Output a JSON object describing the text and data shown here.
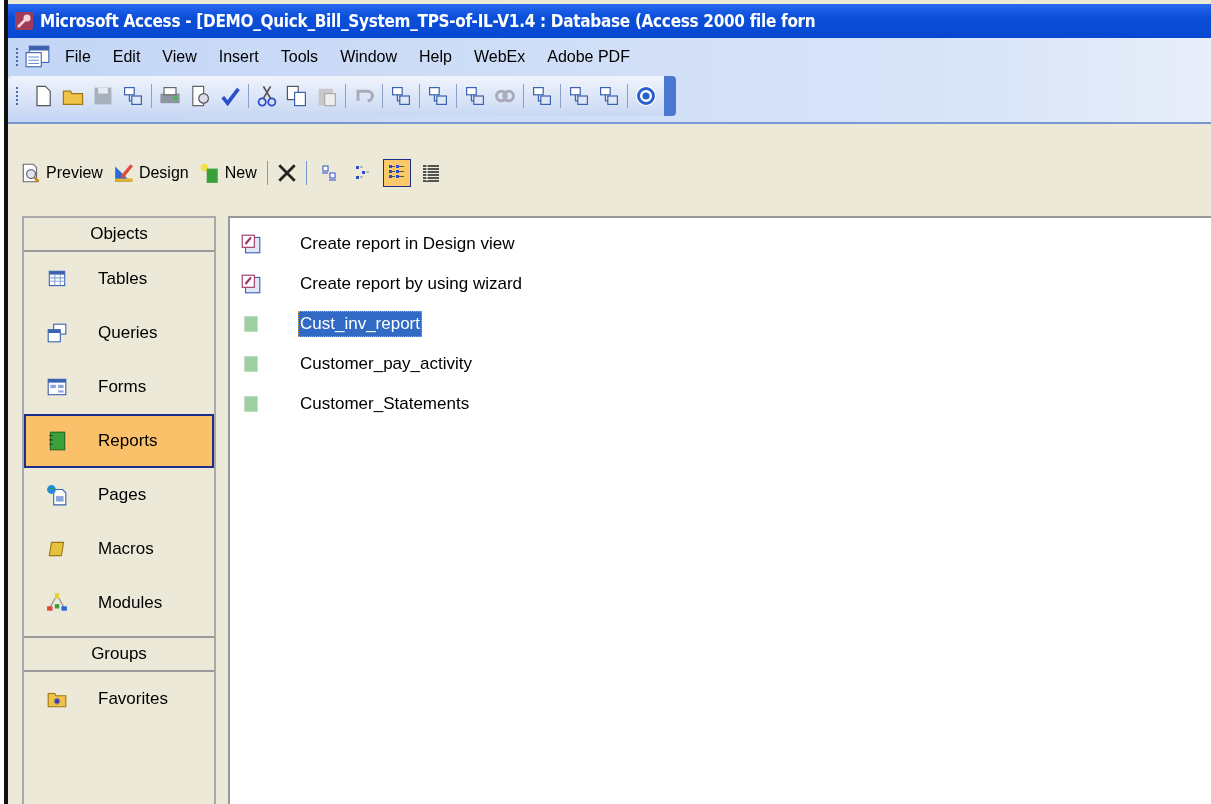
{
  "window": {
    "title": "Microsoft Access - [DEMO_Quick_Bill_System_TPS-of-IL-V1.4 : Database (Access 2000 file forn"
  },
  "menu": [
    {
      "label": "File"
    },
    {
      "label": "Edit"
    },
    {
      "label": "View"
    },
    {
      "label": "Insert"
    },
    {
      "label": "Tools"
    },
    {
      "label": "Window"
    },
    {
      "label": "Help"
    },
    {
      "label": "WebEx"
    },
    {
      "label": "Adobe PDF"
    }
  ],
  "object_toolbar": {
    "buttons": [
      {
        "label": "Preview",
        "kind": "preview"
      },
      {
        "label": "Design",
        "kind": "design"
      },
      {
        "label": "New",
        "kind": "new"
      }
    ],
    "views": [
      {
        "kind": "large",
        "selected": false
      },
      {
        "kind": "small",
        "selected": false
      },
      {
        "kind": "list",
        "selected": true
      },
      {
        "kind": "details",
        "selected": false
      }
    ]
  },
  "sidebar": {
    "objects_header": "Objects",
    "items": [
      {
        "label": "Tables",
        "kind": "tables",
        "selected": false
      },
      {
        "label": "Queries",
        "kind": "queries",
        "selected": false
      },
      {
        "label": "Forms",
        "kind": "forms",
        "selected": false
      },
      {
        "label": "Reports",
        "kind": "reports",
        "selected": true
      },
      {
        "label": "Pages",
        "kind": "pages",
        "selected": false
      },
      {
        "label": "Macros",
        "kind": "macros",
        "selected": false
      },
      {
        "label": "Modules",
        "kind": "modules",
        "selected": false
      }
    ],
    "groups_header": "Groups",
    "groups": [
      {
        "label": "Favorites",
        "selected": false
      }
    ]
  },
  "list": [
    {
      "label": "Create report in Design view",
      "kind": "shortcut",
      "selected": false
    },
    {
      "label": "Create report by using wizard",
      "kind": "shortcut",
      "selected": false
    },
    {
      "label": "Cust_inv_report",
      "kind": "report",
      "selected": true
    },
    {
      "label": "Customer_pay_activity",
      "kind": "report",
      "selected": false
    },
    {
      "label": "Customer_Statements",
      "kind": "report",
      "selected": false
    }
  ]
}
